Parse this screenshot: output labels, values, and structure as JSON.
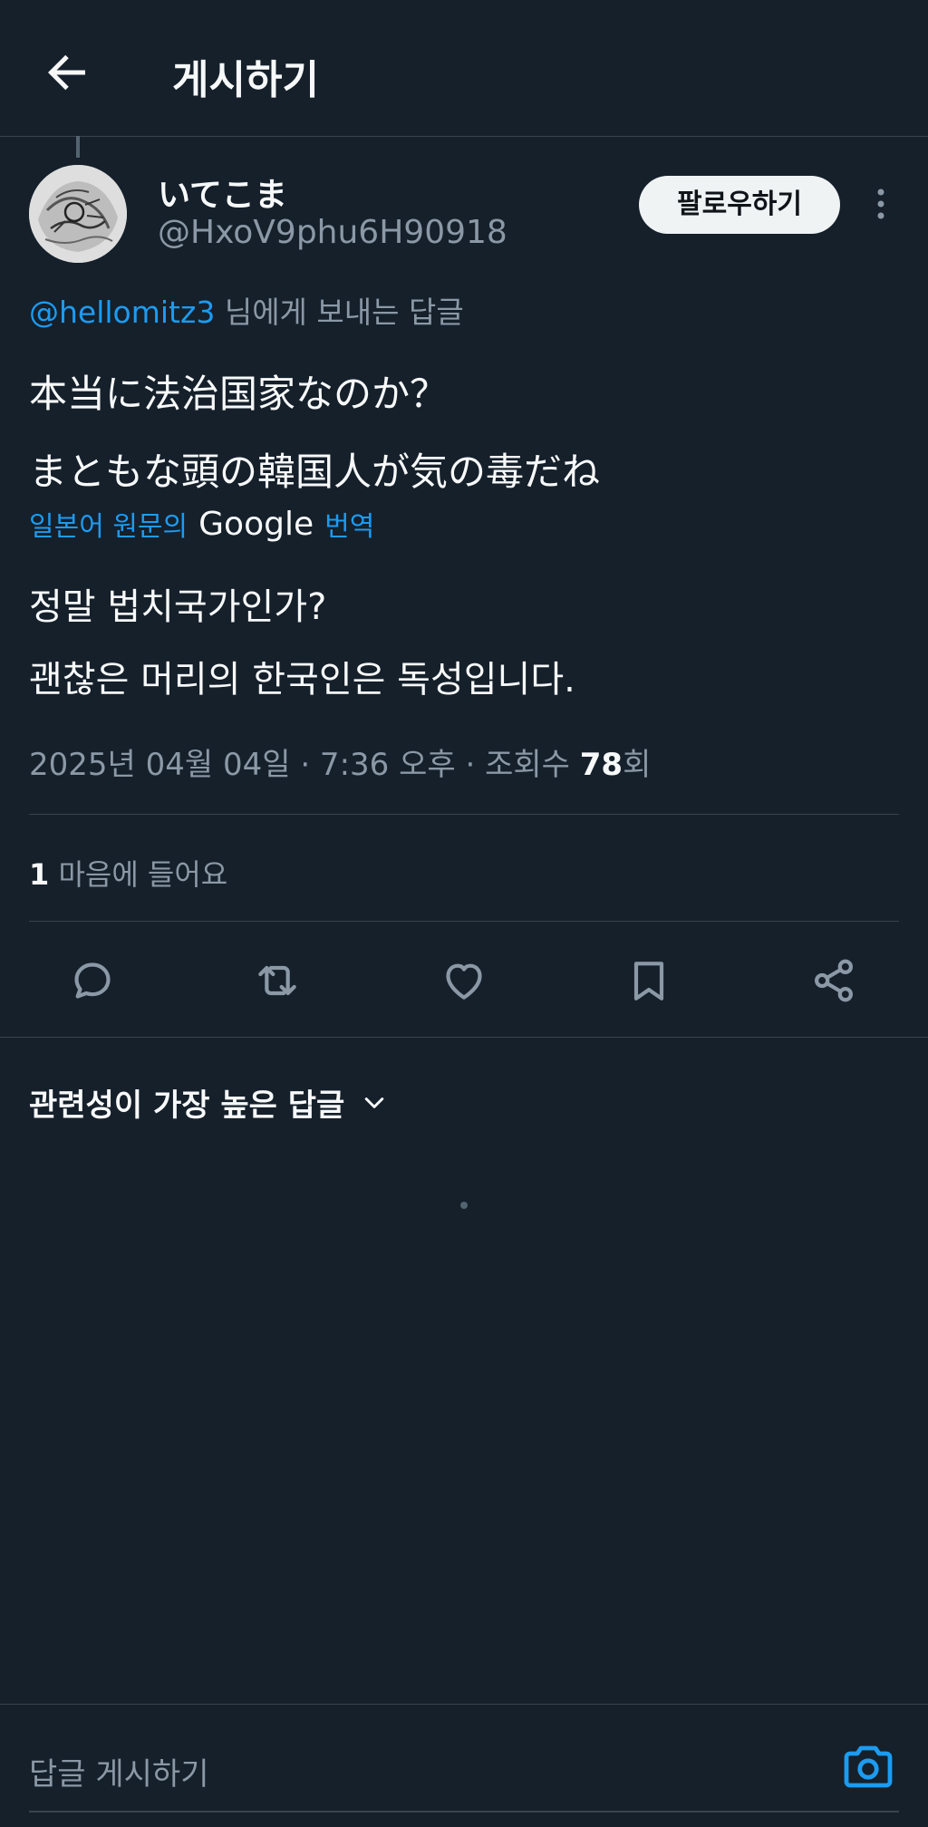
{
  "header": {
    "title": "게시하기",
    "back_icon": "arrow-left-icon"
  },
  "author": {
    "display_name": "いてこま",
    "handle": "@HxoV9phu6H90918",
    "follow_label": "팔로우하기"
  },
  "reply_to": {
    "handle": "@hellomitz3",
    "suffix": "님에게 보내는 답글"
  },
  "tweet": {
    "line1": "本当に法治国家なのか？",
    "line2": "まともな頭の韓国人が気の毒だね"
  },
  "translation": {
    "prefix": "일본어 원문의",
    "provider": "Google",
    "suffix": "번역",
    "line1": "정말 법치국가인가?",
    "line2": "괜찮은 머리의 한국인은 독성입니다."
  },
  "meta": {
    "datetime": "2025년 04월 04일 · 7:36 오후 · 조회수 ",
    "views": "78",
    "views_suffix": "회"
  },
  "likes": {
    "count": "1",
    "label": " 마음에 들어요"
  },
  "actions": [
    "reply-icon",
    "retweet-icon",
    "heart-icon",
    "bookmark-icon",
    "share-icon"
  ],
  "replies": {
    "sort_label": "관련성이 가장 높은 답글"
  },
  "compose": {
    "placeholder": "답글 게시하기"
  },
  "colors": {
    "background": "#15202b",
    "accent": "#1d9bf0",
    "muted": "#8b98a5",
    "border": "#38444d"
  }
}
